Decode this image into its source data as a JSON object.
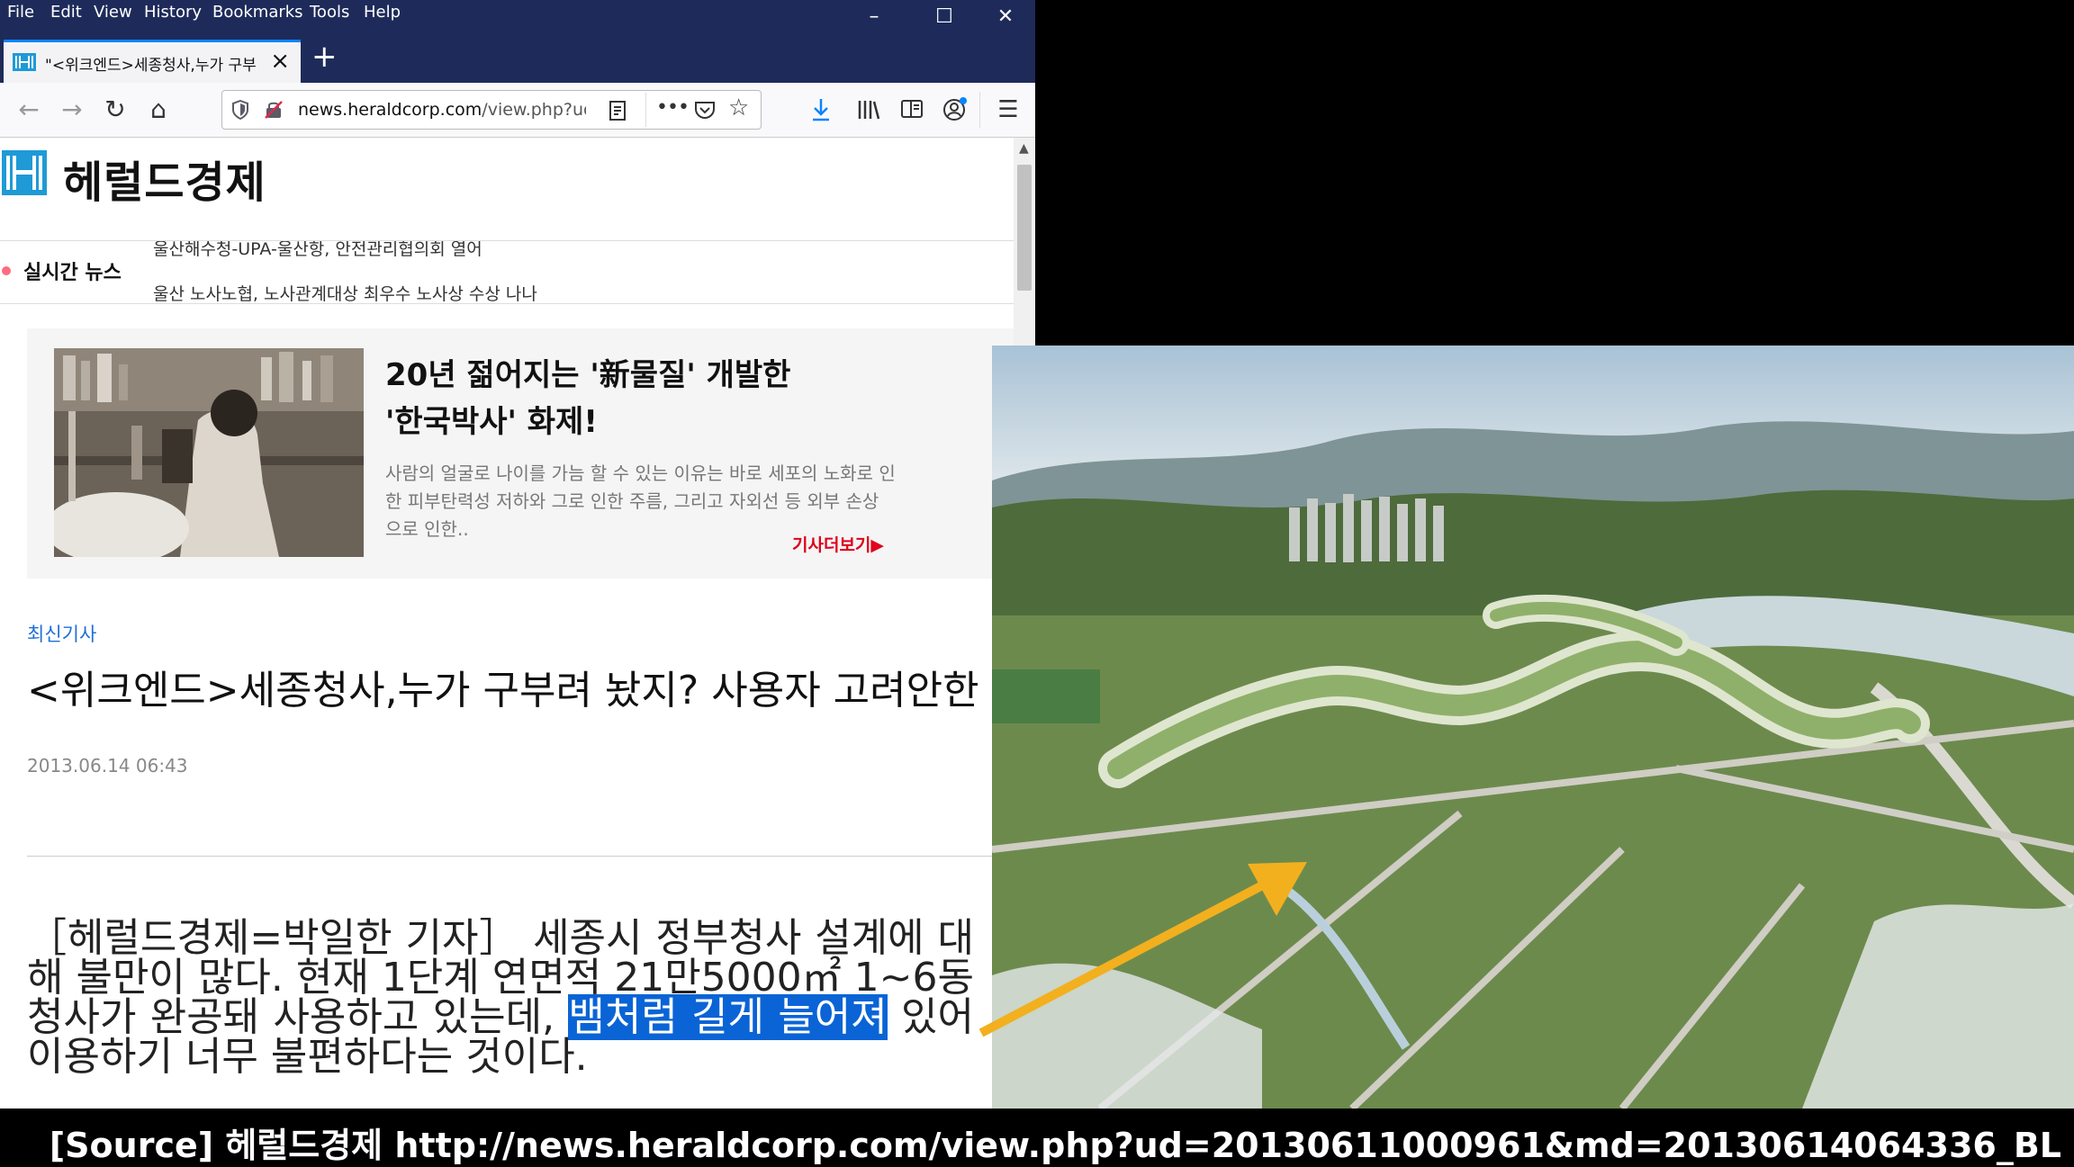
{
  "menu": [
    "File",
    "Edit",
    "View",
    "History",
    "Bookmarks",
    "Tools",
    "Help"
  ],
  "tab": {
    "title": "\"<위크엔드>세종청사,누가 구부"
  },
  "url": {
    "host": "news.heraldcorp.com",
    "path": "/view.php?ud"
  },
  "site": {
    "logo_text": "헤럴드경제"
  },
  "live": {
    "label": "실시간 뉴스",
    "ticker1": "울산해수청-UPA-울산항, 안전관리협의회 열어",
    "ticker2": "울산 노사노협, 노사관계대상 최우수 노사상 수상 나나"
  },
  "promo": {
    "title": "20년 젊어지는 '新물질' 개발한 '한국박사' 화제!",
    "desc": "사람의 얼굴로 나이를 가늠 할 수 있는 이유는 바로 세포의 노화로 인한 피부탄력성 저하와 그로 인한 주름, 그리고 자외선 등 외부 손상 으로 인한..",
    "more": "기사더보기▶"
  },
  "article": {
    "category": "최신기사",
    "headline": "<위크엔드>세종청사,누가 구부려 놨지? 사용자 고려안한",
    "date": "2013.06.14 06:43",
    "body_before": "［헤럴드경제=박일한 기자］ 세종시 정부청사 설계에 대해 불만이 많다. 현재 1단계 연면적 21만5000㎡ 1~6동 청사가 완공돼 사용하고 있는데, ",
    "body_highlight": "뱀처럼 길게 늘어져",
    "body_after": " 있어 이용하기 너무 불편하다는 것이다."
  },
  "caption": "[Source] 헤럴드경제   http://news.heraldcorp.com/view.php?ud=20130611000961&md=20130614064336_BL",
  "colors": {
    "accent": "#0a84ff",
    "titlebar": "#1e2b5a",
    "highlight": "#0a64d6",
    "arrow": "#f2b01e"
  },
  "icons": [
    "back-icon",
    "forward-icon",
    "reload-icon",
    "home-icon",
    "shield-icon",
    "insecure-lock-icon",
    "reader-icon",
    "more-icon",
    "pocket-icon",
    "star-icon",
    "download-icon",
    "library-icon",
    "sidebar-icon",
    "account-icon",
    "menu-icon"
  ]
}
